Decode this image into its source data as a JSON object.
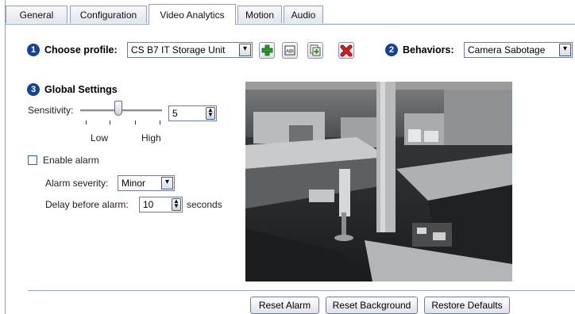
{
  "tabs": [
    {
      "label": "General"
    },
    {
      "label": "Configuration"
    },
    {
      "label": "Video Analytics",
      "active": true
    },
    {
      "label": "Motion"
    },
    {
      "label": "Audio"
    }
  ],
  "profile": {
    "step": "1",
    "label": "Choose profile:",
    "value": "CS B7 IT Storage Unit",
    "icons": [
      "add-icon",
      "rename-icon",
      "copy-icon",
      "delete-icon"
    ]
  },
  "behaviors": {
    "step": "2",
    "label": "Behaviors:",
    "value": "Camera Sabotage"
  },
  "global": {
    "step": "3",
    "title": "Global Settings",
    "sensitivity_label": "Sensitivity:",
    "sensitivity_value": "5",
    "low_label": "Low",
    "high_label": "High",
    "enable_alarm_label": "Enable alarm",
    "enable_alarm_checked": false,
    "alarm_severity_label": "Alarm severity:",
    "alarm_severity_value": "Minor",
    "delay_label": "Delay before alarm:",
    "delay_value": "10",
    "delay_unit": "seconds"
  },
  "buttons": {
    "reset_alarm": "Reset Alarm",
    "reset_background": "Reset Background",
    "restore_defaults": "Restore Defaults"
  },
  "colors": {
    "step_badge": "#18418f",
    "add_icon": "#2a9a2a",
    "delete_icon": "#d42020"
  }
}
